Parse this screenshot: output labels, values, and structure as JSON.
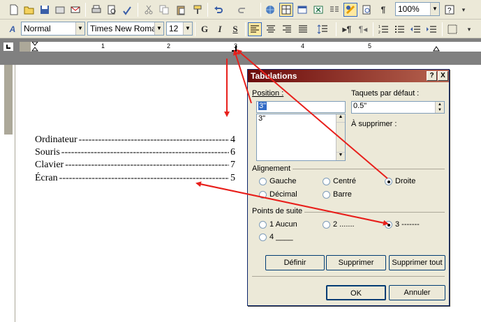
{
  "toolbar1": {
    "zoom": "100%",
    "icons": [
      "new-icon",
      "open-icon",
      "save-icon",
      "permission-icon",
      "email-icon",
      "print-icon",
      "print-preview-icon",
      "spelling-icon",
      "cut-icon",
      "copy-icon",
      "paste-icon",
      "format-painter-icon",
      "undo-icon",
      "redo-icon",
      "hyperlink-icon",
      "tables-borders-icon",
      "insert-table-icon",
      "insert-excel-icon",
      "columns-icon",
      "drawing-icon",
      "document-map-icon",
      "show-hide-icon",
      "help-icon"
    ]
  },
  "toolbar2": {
    "style": "Normal",
    "font": "Times New Roman",
    "size": "12",
    "bold": "G",
    "italic": "I",
    "underline": "S"
  },
  "ruler": {
    "numbers": [
      "1",
      "2",
      "3",
      "4",
      "5"
    ]
  },
  "document": {
    "lines": [
      {
        "label": "Ordinateur",
        "num": "4"
      },
      {
        "label": "Souris",
        "num": "6"
      },
      {
        "label": "Clavier",
        "num": "7"
      },
      {
        "label": "Écran",
        "num": "5"
      }
    ]
  },
  "dialog": {
    "title": "Tabulations",
    "help": "?",
    "close": "X",
    "position_label": "Position :",
    "position_value": "3\"",
    "list_item": "3\"",
    "default_tabs_label": "Taquets par défaut :",
    "default_tabs_value": "0.5\"",
    "clear_label": "À supprimer :",
    "alignment_label": "Alignement",
    "alignment": {
      "gauche": "Gauche",
      "centre": "Centré",
      "droite": "Droite",
      "decimal": "Décimal",
      "barre": "Barre"
    },
    "leader_label": "Points de suite",
    "leader": {
      "aucun": "1 Aucun",
      "two": "2 .......",
      "three": "3 -------",
      "four": "4 ____"
    },
    "buttons": {
      "definir": "Définir",
      "supprimer": "Supprimer",
      "supprimer_tout": "Supprimer tout",
      "ok": "OK",
      "annuler": "Annuler"
    }
  },
  "colors": {
    "arrow": "#e8201c",
    "titlebar": "#8a1a10"
  }
}
